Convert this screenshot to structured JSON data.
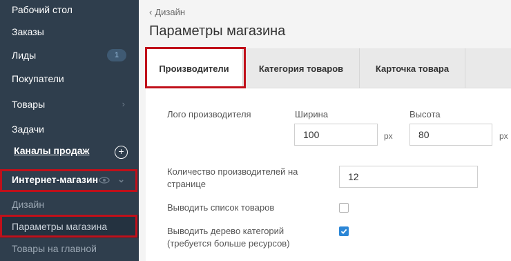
{
  "sidebar": {
    "items": [
      {
        "label": "Рабочий стол"
      },
      {
        "label": "Заказы"
      },
      {
        "label": "Лиды",
        "badge": "1"
      },
      {
        "label": "Покупатели"
      },
      {
        "label": "Товары"
      },
      {
        "label": "Задачи"
      }
    ],
    "section_title": "Каналы продаж",
    "channel": {
      "label": "Интернет-магазин"
    },
    "sub_items": [
      {
        "label": "Дизайн"
      },
      {
        "label": "Параметры магазина"
      },
      {
        "label": "Товары на главной"
      }
    ]
  },
  "main": {
    "breadcrumb": "Дизайн",
    "title": "Параметры магазина",
    "tabs": [
      {
        "label": "Производители",
        "active": true
      },
      {
        "label": "Категория товаров"
      },
      {
        "label": "Карточка товара"
      }
    ],
    "form": {
      "logo_label": "Лого производителя",
      "width_label": "Ширина",
      "width_value": "100",
      "width_unit": "px",
      "height_label": "Высота",
      "height_value": "80",
      "height_unit": "px",
      "count_label_1": "Количество производителей на",
      "count_label_2": "страницe",
      "count_value": "12",
      "show_products_label": "Выводить список товаров",
      "show_products_checked": false,
      "show_tree_label_1": "Выводить дерево категорий",
      "show_tree_label_2": "(требуется больше ресурсов)",
      "show_tree_checked": true
    }
  },
  "colors": {
    "sidebar_bg": "#2f3e4d",
    "highlight_red": "#c0101a",
    "checkbox_blue": "#2b86d6"
  }
}
